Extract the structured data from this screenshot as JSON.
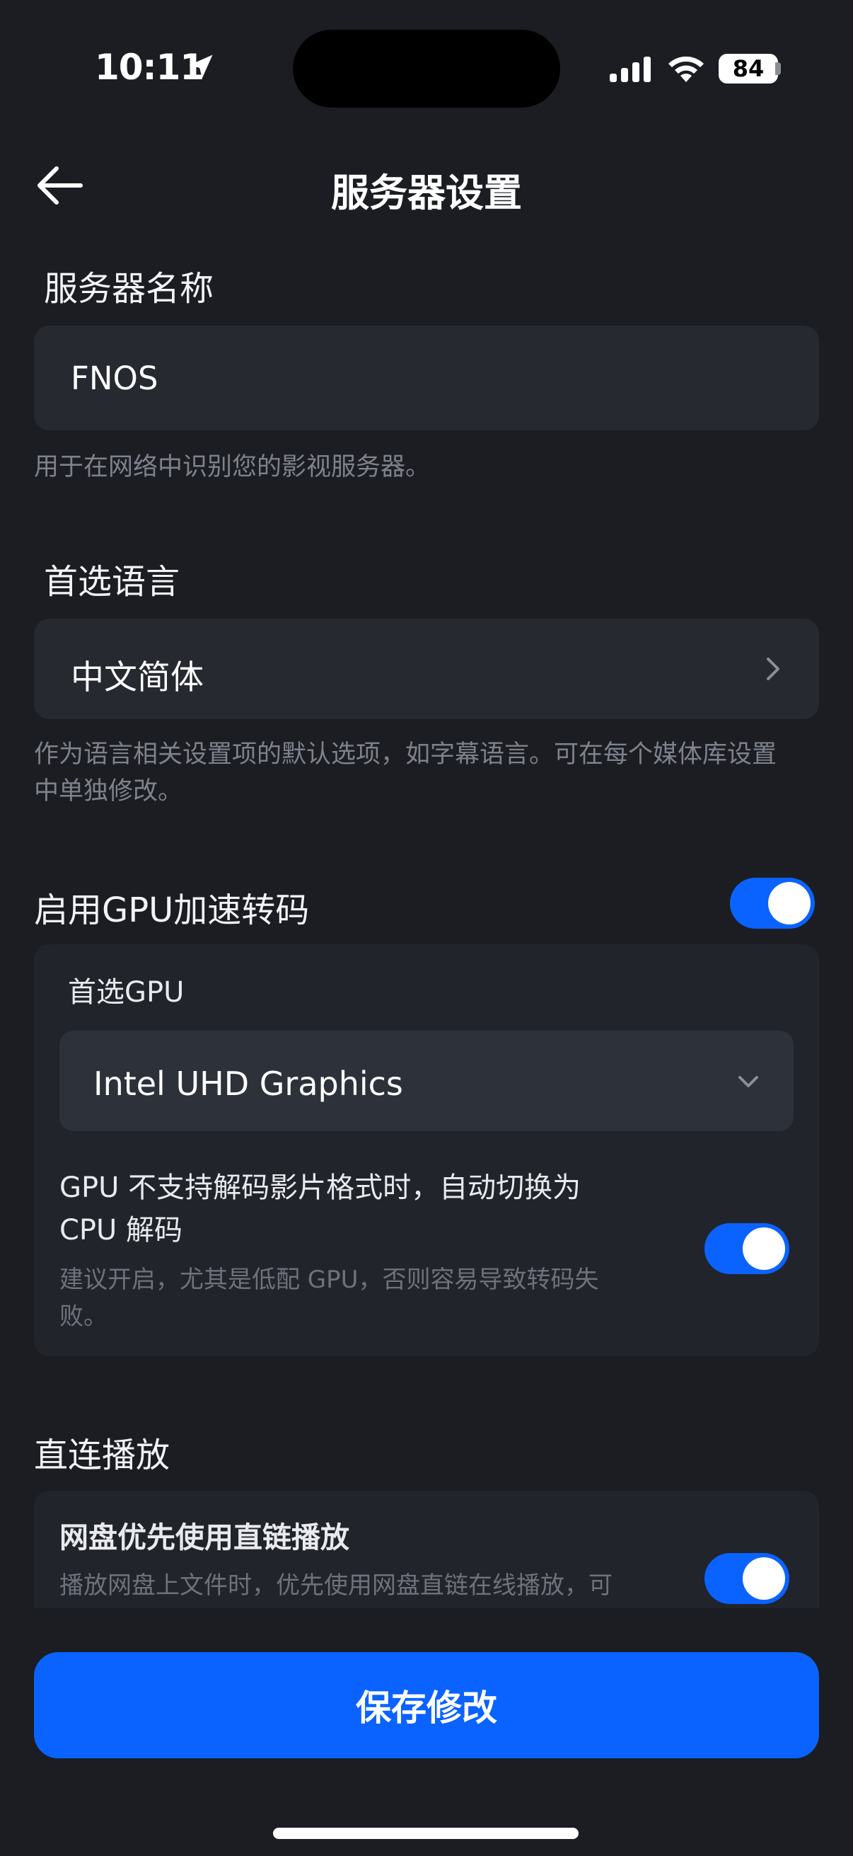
{
  "status_bar": {
    "time": "10:11",
    "battery": "84"
  },
  "header": {
    "title": "服务器设置"
  },
  "server_name": {
    "label": "服务器名称",
    "value": "FNOS",
    "hint": "用于在网络中识别您的影视服务器。"
  },
  "language": {
    "label": "首选语言",
    "value": "中文简体",
    "hint_line1": "作为语言相关设置项的默认选项，如字幕语言。可在每个媒体库设置",
    "hint_line2": "中单独修改。"
  },
  "gpu": {
    "label": "启用GPU加速转码",
    "enabled": true,
    "preferred_label": "首选GPU",
    "preferred_value": "Intel UHD Graphics",
    "fallback_title_line1": "GPU 不支持解码影片格式时，自动切换为",
    "fallback_title_line2": "CPU 解码",
    "fallback_hint_line1": "建议开启，尤其是低配 GPU，否则容易导致转码失",
    "fallback_hint_line2": "败。",
    "fallback_enabled": true
  },
  "direct_play": {
    "label": "直连播放",
    "cloud_title": "网盘优先使用直链播放",
    "cloud_hint": "播放网盘上文件时，优先使用网盘直链在线播放，可",
    "cloud_enabled": true
  },
  "actions": {
    "save_label": "保存修改"
  },
  "colors": {
    "background": "#1b1d22",
    "accent": "#0a63ff",
    "field": "#262930",
    "hint": "#7d828c"
  }
}
